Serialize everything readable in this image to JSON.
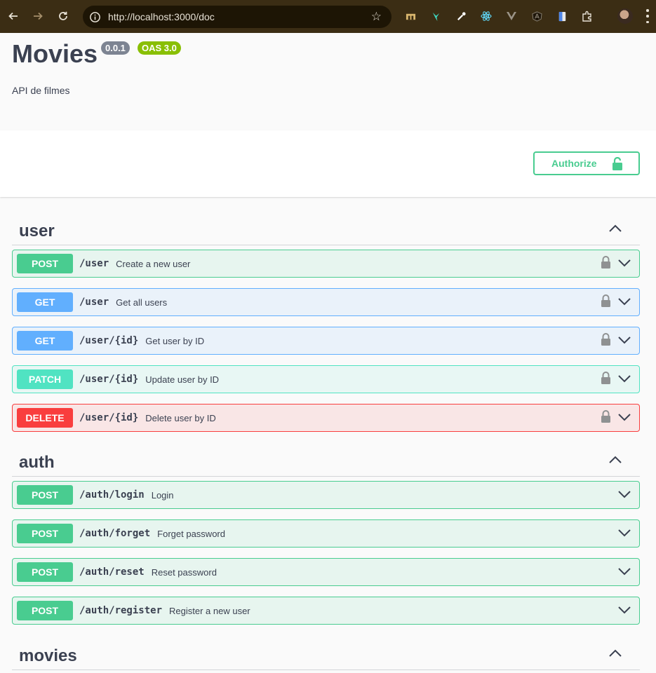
{
  "browser": {
    "url": "http://localhost:3000/doc"
  },
  "info": {
    "title": "Movies",
    "version": "0.0.1",
    "oas": "OAS 3.0",
    "description": "API de filmes"
  },
  "authorize_label": "Authorize",
  "tags": [
    {
      "name": "user",
      "operations": [
        {
          "method": "POST",
          "path": "/user",
          "summary": "Create a new user",
          "locked": true
        },
        {
          "method": "GET",
          "path": "/user",
          "summary": "Get all users",
          "locked": true
        },
        {
          "method": "GET",
          "path": "/user/{id}",
          "summary": "Get user by ID",
          "locked": true
        },
        {
          "method": "PATCH",
          "path": "/user/{id}",
          "summary": "Update user by ID",
          "locked": true
        },
        {
          "method": "DELETE",
          "path": "/user/{id}",
          "summary": "Delete user by ID",
          "locked": true
        }
      ]
    },
    {
      "name": "auth",
      "operations": [
        {
          "method": "POST",
          "path": "/auth/login",
          "summary": "Login",
          "locked": false
        },
        {
          "method": "POST",
          "path": "/auth/forget",
          "summary": "Forget password",
          "locked": false
        },
        {
          "method": "POST",
          "path": "/auth/reset",
          "summary": "Reset password",
          "locked": false
        },
        {
          "method": "POST",
          "path": "/auth/register",
          "summary": "Register a new user",
          "locked": false
        }
      ]
    },
    {
      "name": "movies",
      "operations": []
    }
  ]
}
